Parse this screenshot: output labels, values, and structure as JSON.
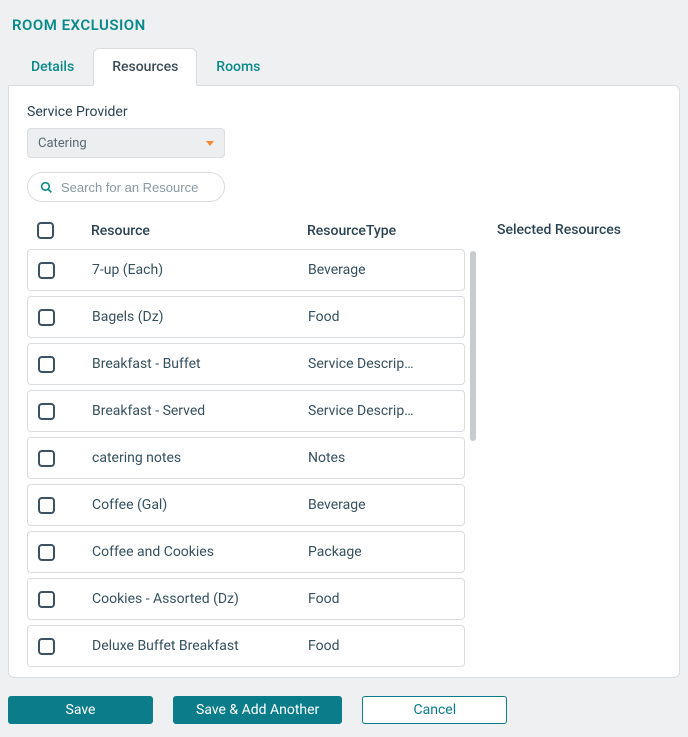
{
  "title": "ROOM EXCLUSION",
  "tabs": {
    "details": "Details",
    "resources": "Resources",
    "rooms": "Rooms"
  },
  "provider": {
    "label": "Service Provider",
    "value": "Catering"
  },
  "search": {
    "placeholder": "Search for an Resource"
  },
  "headers": {
    "resource": "Resource",
    "type": "ResourceType"
  },
  "selected": {
    "title": "Selected Resources"
  },
  "rows": [
    {
      "name": "7-up (Each)",
      "type": "Beverage"
    },
    {
      "name": "Bagels (Dz)",
      "type": "Food"
    },
    {
      "name": "Breakfast - Buffet",
      "type": "Service Descrip…"
    },
    {
      "name": "Breakfast - Served",
      "type": "Service Descrip…"
    },
    {
      "name": "catering notes",
      "type": "Notes"
    },
    {
      "name": "Coffee (Gal)",
      "type": "Beverage"
    },
    {
      "name": "Coffee and Cookies",
      "type": "Package"
    },
    {
      "name": "Cookies - Assorted (Dz)",
      "type": "Food"
    },
    {
      "name": "Deluxe Buffet Breakfast",
      "type": "Food"
    }
  ],
  "buttons": {
    "save": "Save",
    "saveAnother": "Save & Add Another",
    "cancel": "Cancel"
  }
}
